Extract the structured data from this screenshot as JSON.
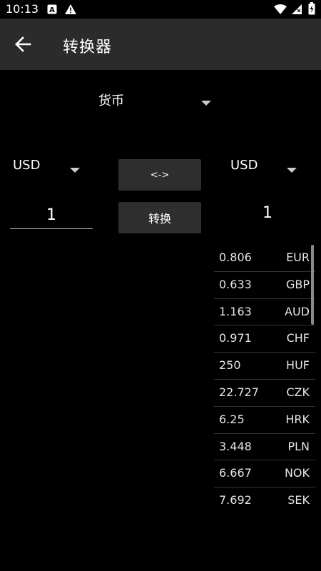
{
  "status_bar": {
    "time": "10:13"
  },
  "app_bar": {
    "title": "转换器"
  },
  "category": {
    "selected": "货币"
  },
  "from": {
    "currency": "USD",
    "amount": "1"
  },
  "to": {
    "currency": "USD",
    "result": "1"
  },
  "buttons": {
    "swap_label": "<->",
    "convert_label": "转换"
  },
  "rates": [
    {
      "value": "0.806",
      "code": "EUR"
    },
    {
      "value": "0.633",
      "code": "GBP"
    },
    {
      "value": "1.163",
      "code": "AUD"
    },
    {
      "value": "0.971",
      "code": "CHF"
    },
    {
      "value": "250",
      "code": "HUF"
    },
    {
      "value": "22.727",
      "code": "CZK"
    },
    {
      "value": "6.25",
      "code": "HRK"
    },
    {
      "value": "3.448",
      "code": "PLN"
    },
    {
      "value": "6.667",
      "code": "NOK"
    },
    {
      "value": "7.692",
      "code": "SEK"
    }
  ]
}
